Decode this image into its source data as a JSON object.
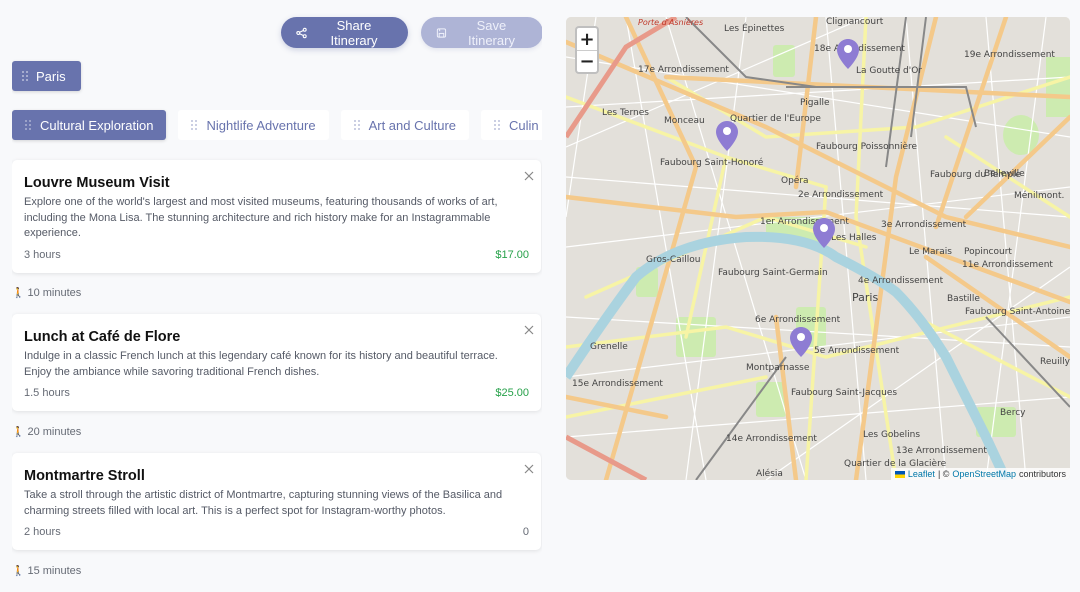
{
  "toolbar": {
    "share_label": "Share Itinerary",
    "save_label": "Save Itinerary"
  },
  "city": {
    "label": "Paris"
  },
  "themes": [
    {
      "label": "Cultural Exploration",
      "active": true
    },
    {
      "label": "Nightlife Adventure",
      "active": false
    },
    {
      "label": "Art and Culture",
      "active": false
    },
    {
      "label": "Culin",
      "active": false
    }
  ],
  "activities": [
    {
      "title": "Louvre Museum Visit",
      "description": "Explore one of the world's largest and most visited museums, featuring thousands of works of art, including the Mona Lisa. The stunning architecture and rich history make for an Instagrammable experience.",
      "duration": "3 hours",
      "price": "$17.00",
      "travel_after": "10 minutes"
    },
    {
      "title": "Lunch at Café de Flore",
      "description": "Indulge in a classic French lunch at this legendary café known for its history and beautiful terrace. Enjoy the ambiance while savoring traditional French dishes.",
      "duration": "1.5 hours",
      "price": "$25.00",
      "travel_after": "20 minutes"
    },
    {
      "title": "Montmartre Stroll",
      "description": "Take a stroll through the artistic district of Montmartre, capturing stunning views of the Basilica and charming streets filled with local art. This is a perfect spot for Instagram-worthy photos.",
      "duration": "2 hours",
      "price": "0",
      "travel_after": "15 minutes"
    }
  ],
  "map": {
    "zoom_in": "+",
    "zoom_out": "−",
    "attribution": {
      "leaflet": "Leaflet",
      "separator": "| ©",
      "osm": "OpenStreetMap",
      "suffix": "contributors"
    },
    "labels": [
      "Porte d'Asnières",
      "Les Épinettes",
      "Clignancourt",
      "18e Arrondissement",
      "La Goutte d'Or",
      "17e Arrondissement",
      "19e Arrondissement",
      "Pigalle",
      "Les Ternes",
      "Monceau",
      "Quartier de l'Europe",
      "Faubourg Saint-Honoré",
      "Faubourg Poissonnière",
      "Opéra",
      "Faubourg du Temple",
      "Belleville",
      "Ménilmont.",
      "2e Arrondissement",
      "1er Arrondissement",
      "3e Arrondissement",
      "Les Halles",
      "Le Marais",
      "Popincourt",
      "11e Arrondissement",
      "Gros-Caillou",
      "Faubourg Saint-Germain",
      "4e Arrondissement",
      "Paris",
      "Bastille",
      "Faubourg Saint-Antoine",
      "6e Arrondissement",
      "Grenelle",
      "5e Arrondissement",
      "Reuilly",
      "Montparnasse",
      "15e Arrondissement",
      "Faubourg Saint-Jacques",
      "Bercy",
      "14e Arrondissement",
      "Les Gobelins",
      "Alésia",
      "Quartier de la Glacière",
      "13e Arrondissement"
    ],
    "marker_color": "#8e7cd3"
  },
  "colors": {
    "accent": "#6873ad",
    "accent_disabled": "#aeb4d6",
    "price": "#27a14a"
  }
}
